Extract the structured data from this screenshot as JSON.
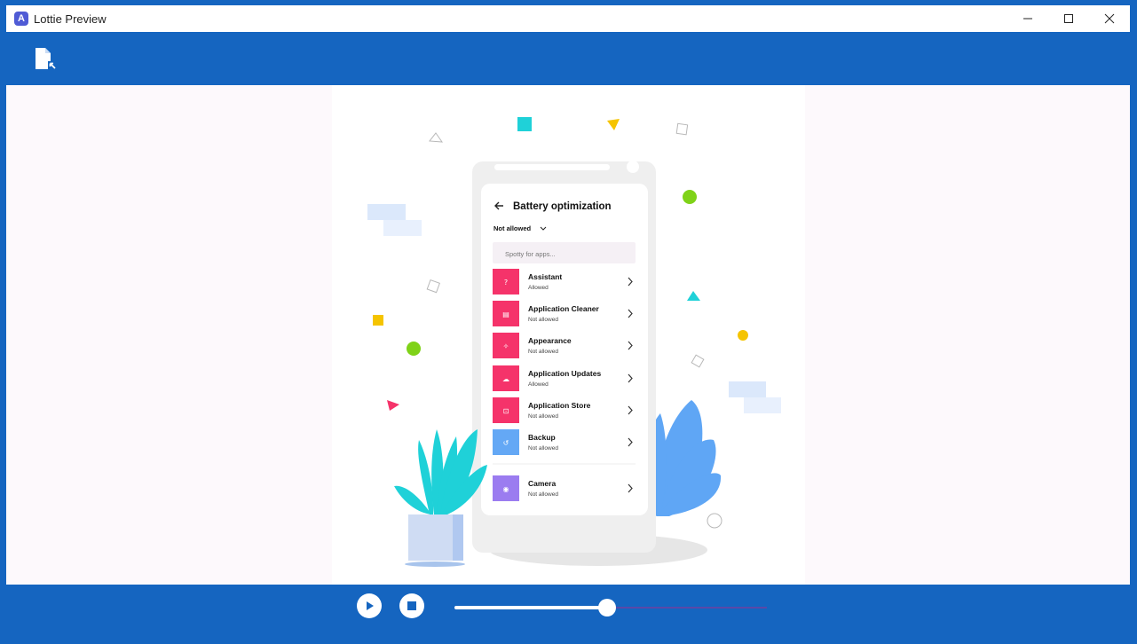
{
  "window": {
    "title": "Lottie Preview",
    "app_icon_letter": "A",
    "minimize_icon": "minimize-icon",
    "maximize_icon": "maximize-icon",
    "close_icon": "close-icon"
  },
  "toolbar": {
    "open_icon": "open-file-icon"
  },
  "phone": {
    "header": "Battery optimization",
    "filter_label": "Not allowed",
    "search_placeholder": "Spotty for apps...",
    "items": [
      {
        "name": "Assistant",
        "status": "Allowed",
        "color": "#f5336a",
        "glyph": "?"
      },
      {
        "name": "Application Cleaner",
        "status": "Not allowed",
        "color": "#f5336a",
        "glyph": "▤"
      },
      {
        "name": "Appearance",
        "status": "Not allowed",
        "color": "#f5336a",
        "glyph": "✧"
      },
      {
        "name": "Application Updates",
        "status": "Allowed",
        "color": "#f5336a",
        "glyph": "☁"
      },
      {
        "name": "Application Store",
        "status": "Not allowed",
        "color": "#f5336a",
        "glyph": "⊡"
      },
      {
        "name": "Backup",
        "status": "Not allowed",
        "color": "#64a8f5",
        "glyph": "↺"
      },
      {
        "name": "Camera",
        "status": "Not allowed",
        "color": "#9b7cf0",
        "glyph": "◉"
      }
    ]
  },
  "colors": {
    "brand": "#1565c0",
    "accent_pink": "#f5336a",
    "teal": "#1fd1d8",
    "green": "#7fd218",
    "yellow": "#f5c400",
    "leaf_blue": "#5fa6f5"
  },
  "player": {
    "play_icon": "play-icon",
    "stop_icon": "stop-icon",
    "progress": 0.49
  }
}
